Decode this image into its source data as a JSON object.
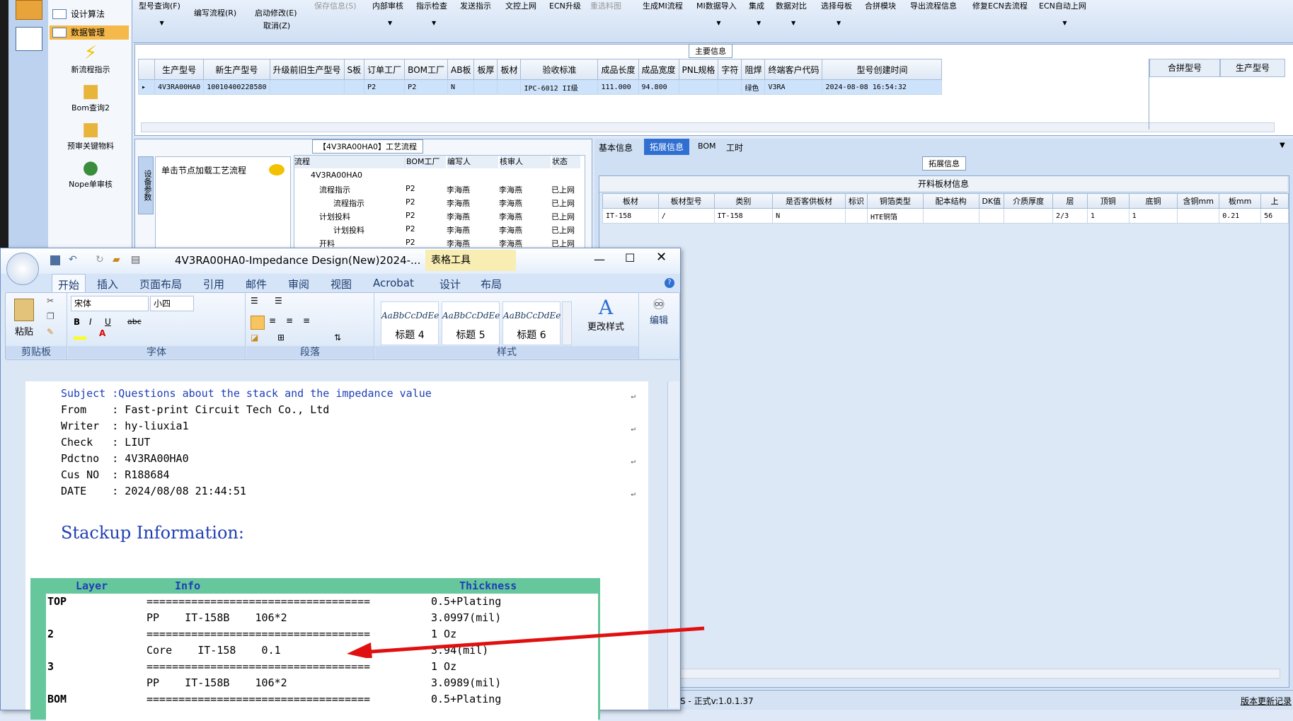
{
  "nav": {
    "items": [
      {
        "label": "设计算法"
      },
      {
        "label": "数据管理"
      }
    ],
    "tiles": [
      {
        "label": "新流程指示",
        "icon": "lightning-icon"
      },
      {
        "label": "Bom查询2",
        "icon": "folder-icon"
      },
      {
        "label": "预审关键物料",
        "icon": "folder-icon"
      },
      {
        "label": "Nope单审核",
        "icon": "user-icon"
      }
    ]
  },
  "toolbar": {
    "items": [
      "型号查询(F)",
      "编写流程(R)",
      "启动修改(E)",
      "取消(Z)",
      "保存信息(S)",
      "内部审核",
      "指示检查",
      "发送指示",
      "文控上网",
      "ECN升级",
      "重选料图",
      "生成MI流程",
      "MI数据导入",
      "集成",
      "数据对比",
      "选择母板",
      "合拼模块",
      "导出流程信息",
      "修复ECN去流程",
      "ECN自动上网"
    ]
  },
  "main_info": {
    "title": "主要信息",
    "columns": [
      "生产型号",
      "新生产型号",
      "升级前旧生产型号",
      "S板",
      "订单工厂",
      "BOM工厂",
      "AB板",
      "板厚",
      "板材",
      "验收标准",
      "成品长度",
      "成品宽度",
      "PNL规格",
      "字符",
      "阻焊",
      "终端客户代码",
      "型号创建时间"
    ],
    "row": [
      "4V3RA00HA0",
      "10010400228580",
      "",
      "",
      "P2",
      "P2",
      "N",
      "",
      "",
      "IPC-6012 II级",
      "111.000",
      "94.800",
      "",
      "",
      "绿色",
      "V3RA",
      "2024-08-08 16:54:32"
    ],
    "side_columns": [
      "合拼型号",
      "生产型号"
    ]
  },
  "process": {
    "title": "【4V3RA00HA0】工艺流程",
    "side_tab": "设备参数",
    "hint": "单击节点加载工艺流程",
    "columns": [
      "流程",
      "BOM工厂",
      "编写人",
      "核审人",
      "状态"
    ],
    "rows": [
      [
        "4V3RA00HA0",
        "",
        "",
        "",
        ""
      ],
      [
        "流程指示",
        "P2",
        "李海燕",
        "李海燕",
        "已上网"
      ],
      [
        "流程指示",
        "P2",
        "李海燕",
        "李海燕",
        "已上网"
      ],
      [
        "计划投料",
        "P2",
        "李海燕",
        "李海燕",
        "已上网"
      ],
      [
        "计划投料",
        "P2",
        "李海燕",
        "李海燕",
        "已上网"
      ],
      [
        "开料",
        "P2",
        "李海燕",
        "李海燕",
        "已上网"
      ]
    ]
  },
  "right_tabs": [
    "基本信息",
    "拓展信息",
    "BOM",
    "工时"
  ],
  "ext_info": {
    "title": "拓展信息",
    "subtitle": "开料板材信息",
    "columns": [
      "板材",
      "板材型号",
      "类别",
      "是否客供板材",
      "标识",
      "铜箔类型",
      "配本结构",
      "DK值",
      "介质厚度",
      "层",
      "顶铜",
      "底铜",
      "含铜mm",
      "板mm",
      "上"
    ],
    "row": [
      "IT-158",
      "/",
      "IT-158",
      "N",
      "",
      "HTE铜箔",
      "",
      "",
      "",
      "2/3",
      "1",
      "1",
      "",
      "0.21",
      "56"
    ]
  },
  "status": {
    "text": "S - 正式v:1.0.1.37",
    "right": "版本更新记录"
  },
  "word": {
    "title": "4V3RA00HA0-Impedance Design(New)2024-...",
    "context_tab": "表格工具",
    "tabs": [
      "开始",
      "插入",
      "页面布局",
      "引用",
      "邮件",
      "审阅",
      "视图",
      "Acrobat",
      "设计",
      "布局"
    ],
    "font_name": "宋体",
    "font_size": "小四",
    "groups": [
      "剪贴板",
      "字体",
      "段落",
      "样式"
    ],
    "paste": "粘贴",
    "styles": [
      {
        "preview": "AaBbCcDdEe",
        "name": "标题 4"
      },
      {
        "preview": "AaBbCcDdEe",
        "name": "标题 5"
      },
      {
        "preview": "AaBbCcDdEe",
        "name": "标题 6"
      }
    ],
    "change_styles": "更改样式",
    "edit": "编辑",
    "doc": {
      "subject": "Subject :Questions about the stack and the impedance value",
      "lines": [
        "From    : Fast-print Circuit Tech Co., Ltd",
        "Writer  : hy-liuxia1",
        "Check   : LIUT",
        "Pdctno  : 4V3RA00HA0",
        "Cus NO  : R188684",
        "DATE    : 2024/08/08 21:44:51"
      ],
      "heading": "Stackup Information:",
      "stack_headers": [
        "Layer",
        "Info",
        "Thickness"
      ],
      "stack_rows": [
        [
          "TOP",
          "===================================",
          "0.5+Plating"
        ],
        [
          "",
          "PP    IT-158B    106*2",
          "3.0997(mil)"
        ],
        [
          "2",
          "===================================",
          "1 Oz"
        ],
        [
          "",
          "Core    IT-158    0.1",
          "3.94(mil)"
        ],
        [
          "3",
          "===================================",
          "1 Oz"
        ],
        [
          "",
          "PP    IT-158B    106*2",
          "3.0989(mil)"
        ],
        [
          "BOM",
          "===================================",
          "0.5+Plating"
        ]
      ]
    }
  },
  "colors": {
    "accent": "#2f6fd1",
    "arrow": "#e01010",
    "table_bg": "#66c79c"
  }
}
